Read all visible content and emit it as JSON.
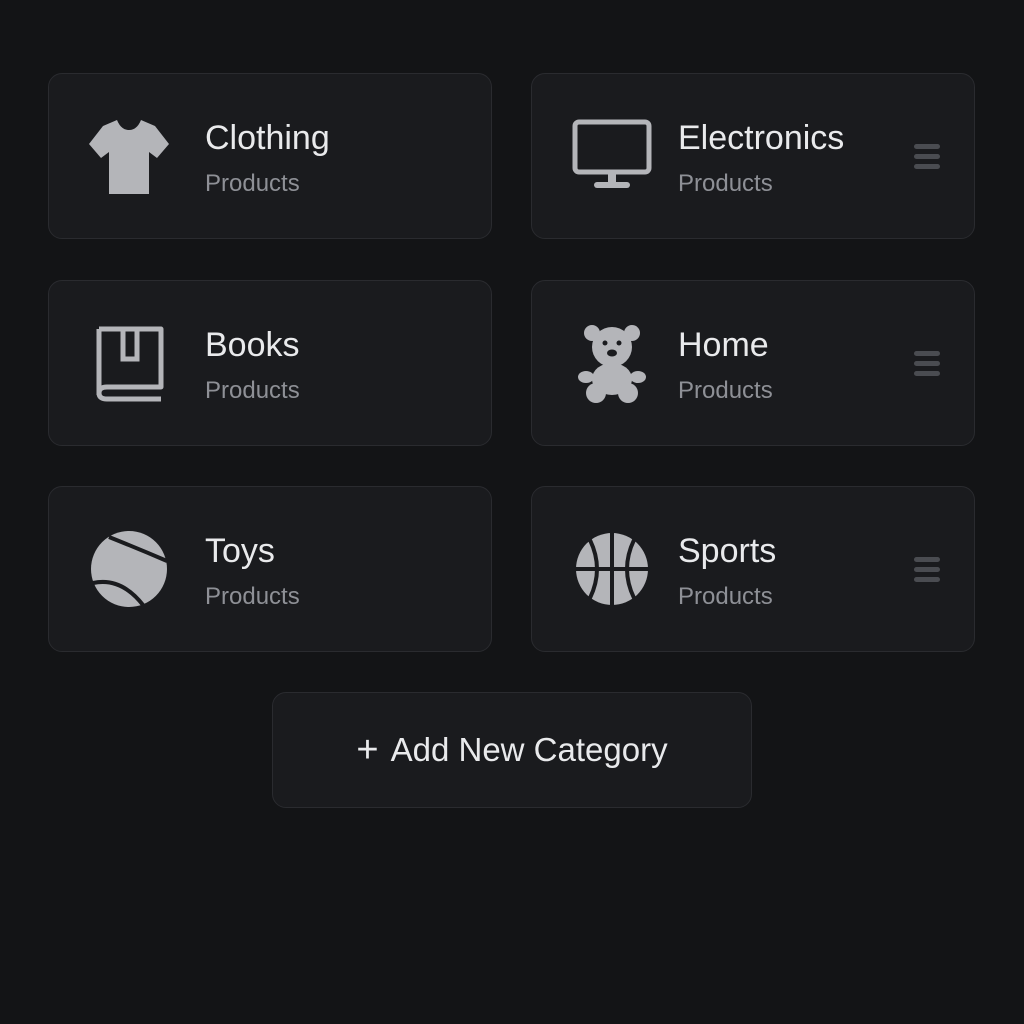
{
  "categories": [
    {
      "name": "Clothing",
      "subtitle": "Products",
      "icon": "tshirt-icon"
    },
    {
      "name": "Electronics",
      "subtitle": "Products",
      "icon": "monitor-icon"
    },
    {
      "name": "Books",
      "subtitle": "Products",
      "icon": "book-icon"
    },
    {
      "name": "Home",
      "subtitle": "Products",
      "icon": "teddy-bear-icon"
    },
    {
      "name": "Toys",
      "subtitle": "Products",
      "icon": "tennis-ball-icon"
    },
    {
      "name": "Sports",
      "subtitle": "Products",
      "icon": "basketball-icon"
    }
  ],
  "add_button": {
    "plus": "+",
    "label": "Add New Category"
  },
  "colors": {
    "background": "#131416",
    "card": "#1a1b1e",
    "border": "#2a2b2f",
    "title": "#e9eaec",
    "subtitle": "#8e9096",
    "icon": "#b4b5b9",
    "handle": "#4a4c51"
  }
}
